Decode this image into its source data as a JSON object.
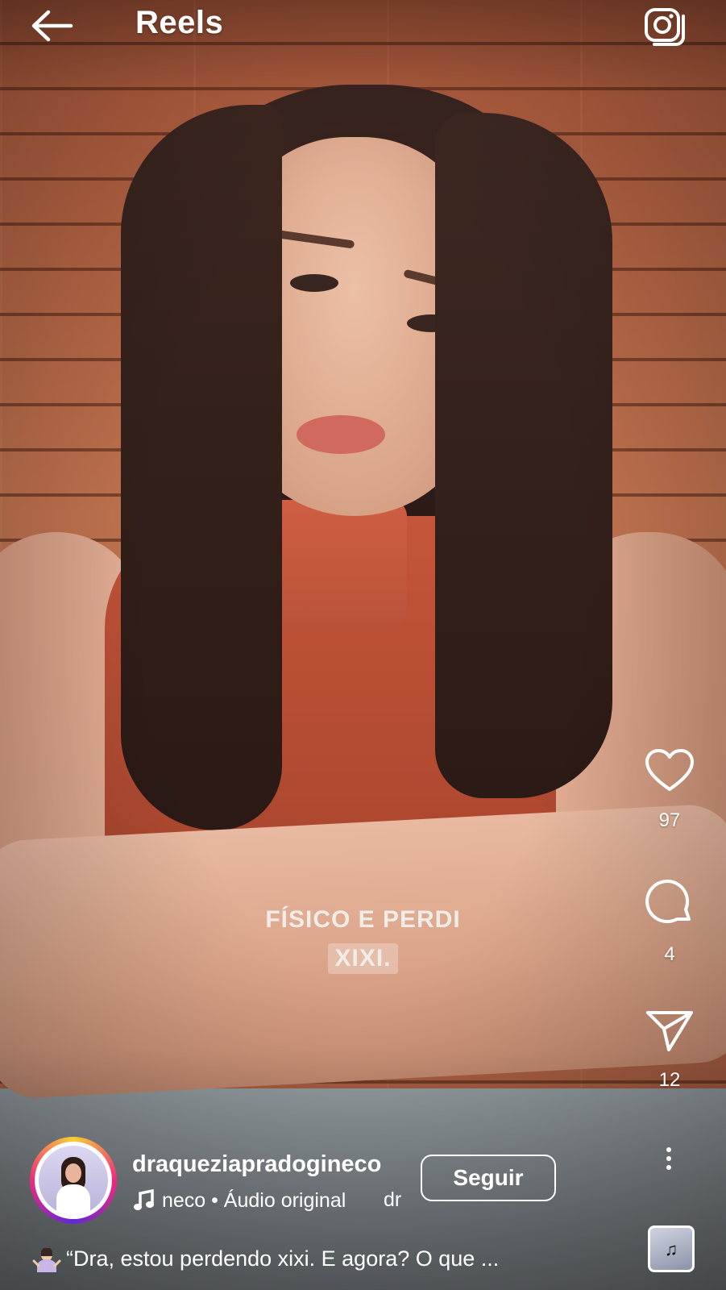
{
  "header": {
    "title": "Reels",
    "back_icon": "arrow-left-icon",
    "camera_icon": "camera-icon"
  },
  "video": {
    "caption_line1": "FÍSICO E PERDI",
    "caption_line2": "XIXI."
  },
  "actions": {
    "likes": "97",
    "comments": "4",
    "shares": "12",
    "like_icon": "heart-icon",
    "comment_icon": "comment-icon",
    "share_icon": "paper-plane-icon",
    "more_icon": "more-vertical-icon"
  },
  "author": {
    "username": "draqueziapradogineco",
    "follow_label": "Seguir",
    "audio_text": "neco • Áudio original",
    "audio_tail": "dr"
  },
  "post": {
    "description": "“Dra, estou perdendo xixi. E agora? O que ..."
  },
  "colors": {
    "text": "#ffffff",
    "avatar_ring": [
      "#f9ce34",
      "#ee2a7b",
      "#6228d7"
    ]
  }
}
